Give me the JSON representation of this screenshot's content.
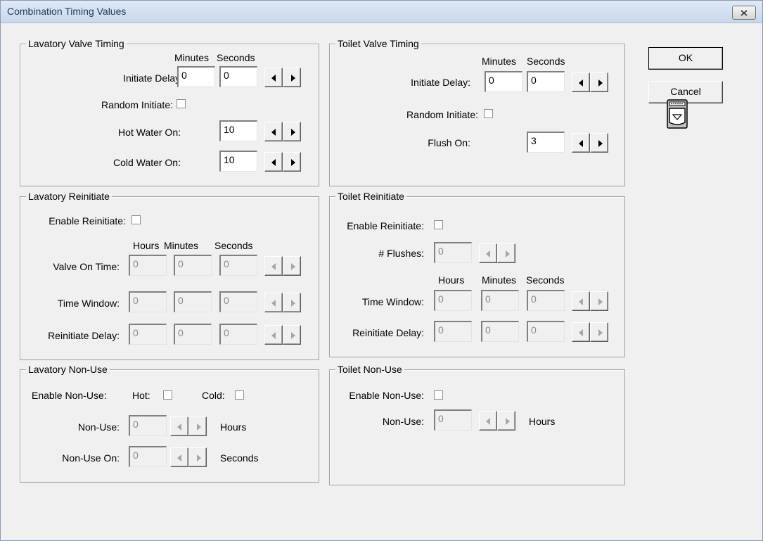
{
  "window": {
    "title": "Combination Timing Values"
  },
  "buttons": {
    "ok": "OK",
    "cancel": "Cancel"
  },
  "lav_valve": {
    "title": "Lavatory Valve Timing",
    "col_minutes": "Minutes",
    "col_seconds": "Seconds",
    "initiate_delay_label": "Initiate Delay:",
    "initiate_min": "0",
    "initiate_sec": "0",
    "random_initiate_label": "Random Initiate:",
    "random_initiate": false,
    "hot_water_label": "Hot Water On:",
    "hot_water": "10",
    "cold_water_label": "Cold Water On:",
    "cold_water": "10"
  },
  "toilet_valve": {
    "title": "Toilet Valve Timing",
    "col_minutes": "Minutes",
    "col_seconds": "Seconds",
    "initiate_delay_label": "Initiate Delay:",
    "initiate_min": "0",
    "initiate_sec": "0",
    "random_initiate_label": "Random Initiate:",
    "random_initiate": false,
    "flush_on_label": "Flush On:",
    "flush_on": "3"
  },
  "lav_reinit": {
    "title": "Lavatory Reinitiate",
    "enable_label": "Enable Reinitiate:",
    "enabled": false,
    "col_hours": "Hours",
    "col_minutes": "Minutes",
    "col_seconds": "Seconds",
    "valve_on_label": "Valve On Time:",
    "valve_on": [
      "0",
      "0",
      "0"
    ],
    "time_window_label": "Time Window:",
    "time_window": [
      "0",
      "0",
      "0"
    ],
    "reinit_delay_label": "Reinitiate Delay:",
    "reinit_delay": [
      "0",
      "0",
      "0"
    ]
  },
  "toilet_reinit": {
    "title": "Toilet Reinitiate",
    "enable_label": "Enable Reinitiate:",
    "enabled": false,
    "flushes_label": "# Flushes:",
    "flushes": "0",
    "col_hours": "Hours",
    "col_minutes": "Minutes",
    "col_seconds": "Seconds",
    "time_window_label": "Time Window:",
    "time_window": [
      "0",
      "0",
      "0"
    ],
    "reinit_delay_label": "Reinitiate Delay:",
    "reinit_delay": [
      "0",
      "0",
      "0"
    ]
  },
  "lav_nonuse": {
    "title": "Lavatory Non-Use",
    "enable_label": "Enable Non-Use:",
    "hot_label": "Hot:",
    "cold_label": "Cold:",
    "hot": false,
    "cold": false,
    "nonuse_label": "Non-Use:",
    "nonuse": "0",
    "nonuse_unit": "Hours",
    "nonuse_on_label": "Non-Use On:",
    "nonuse_on": "0",
    "nonuse_on_unit": "Seconds"
  },
  "toilet_nonuse": {
    "title": "Toilet Non-Use",
    "enable_label": "Enable Non-Use:",
    "enabled": false,
    "nonuse_label": "Non-Use:",
    "nonuse": "0",
    "nonuse_unit": "Hours"
  },
  "icons": {
    "close": "close-icon",
    "device": "toilet-device-icon"
  }
}
